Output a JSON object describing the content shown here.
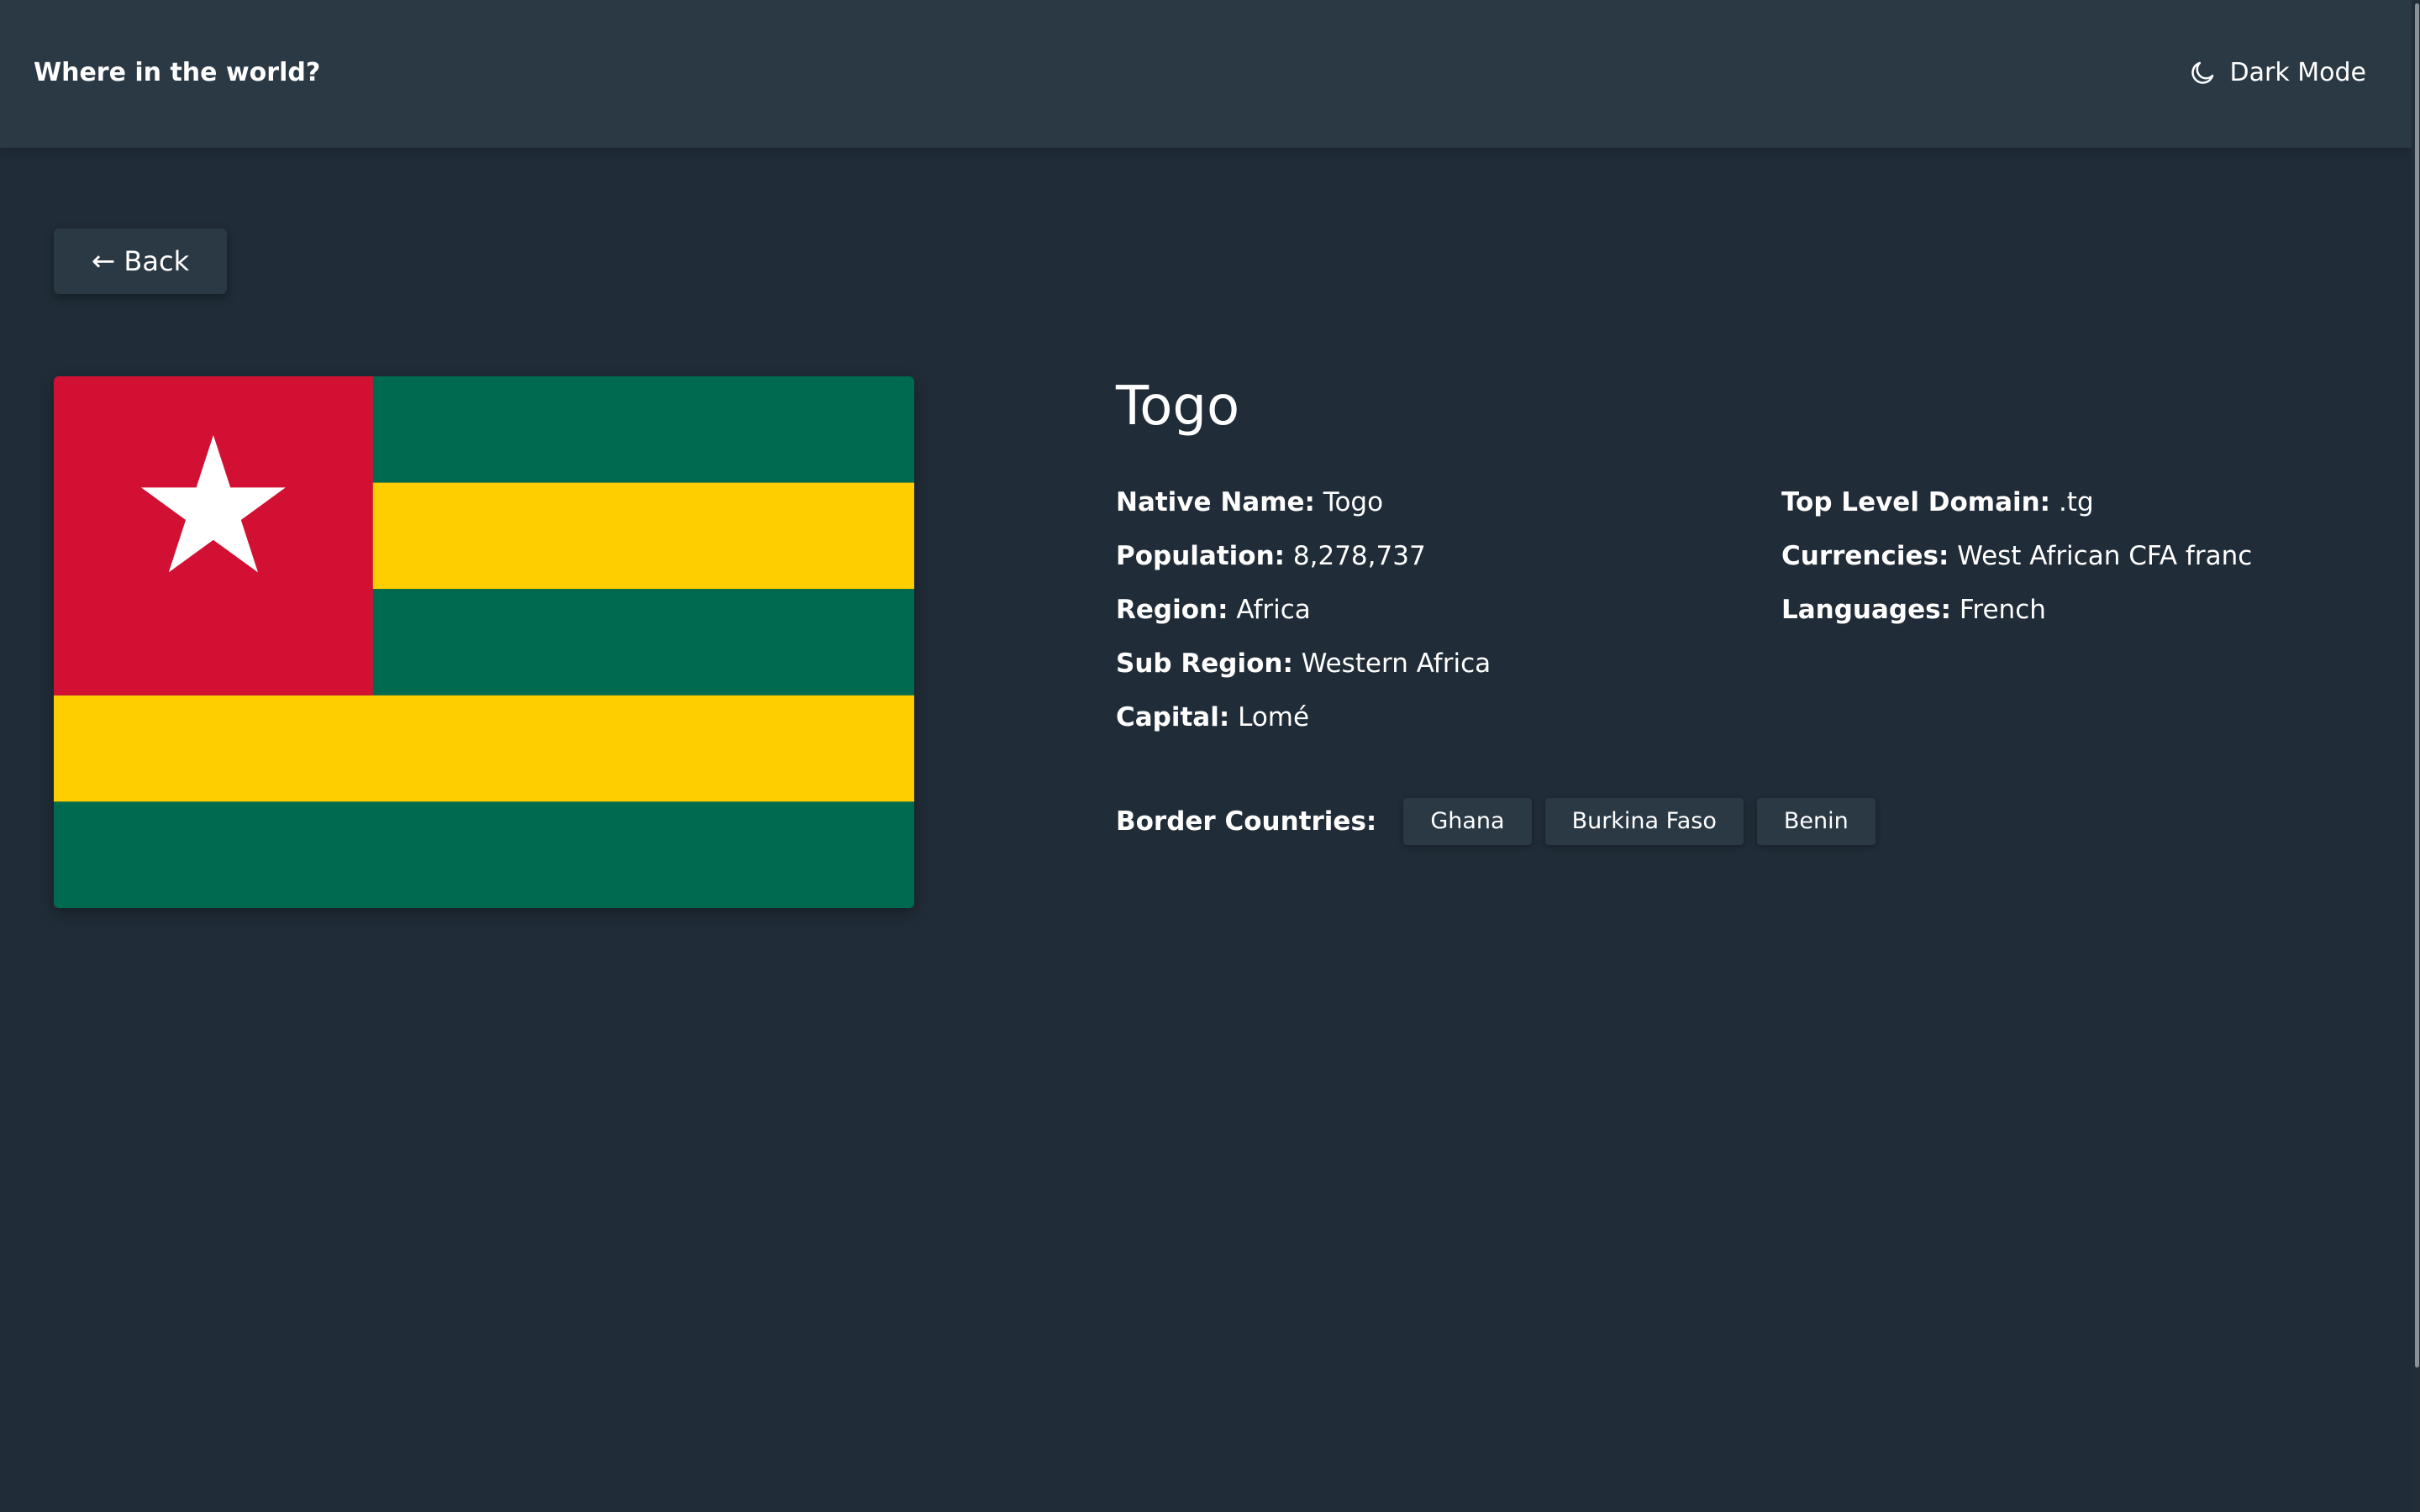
{
  "header": {
    "title": "Where in the world?",
    "theme_toggle_label": "Dark Mode",
    "theme_icon": "moon-icon"
  },
  "back_button": {
    "arrow": "←",
    "label": "Back"
  },
  "flag": {
    "icon": "togo-flag",
    "colors": {
      "green": "#006a4e",
      "yellow": "#ffce00",
      "red": "#d21034",
      "star": "#ffffff"
    }
  },
  "country": {
    "name": "Togo",
    "left_details": [
      {
        "key": "Native Name:",
        "value": "Togo"
      },
      {
        "key": "Population:",
        "value": "8,278,737"
      },
      {
        "key": "Region:",
        "value": "Africa"
      },
      {
        "key": "Sub Region:",
        "value": "Western Africa"
      },
      {
        "key": "Capital:",
        "value": "Lomé"
      }
    ],
    "right_details": [
      {
        "key": "Top Level Domain:",
        "value": ".tg"
      },
      {
        "key": "Currencies:",
        "value": "West African CFA franc"
      },
      {
        "key": "Languages:",
        "value": "French"
      }
    ],
    "border_label": "Border Countries:",
    "borders": [
      "Ghana",
      "Burkina Faso",
      "Benin"
    ]
  },
  "theme": {
    "background": "#202c37",
    "element": "#2b3945",
    "text": "#ffffff"
  }
}
